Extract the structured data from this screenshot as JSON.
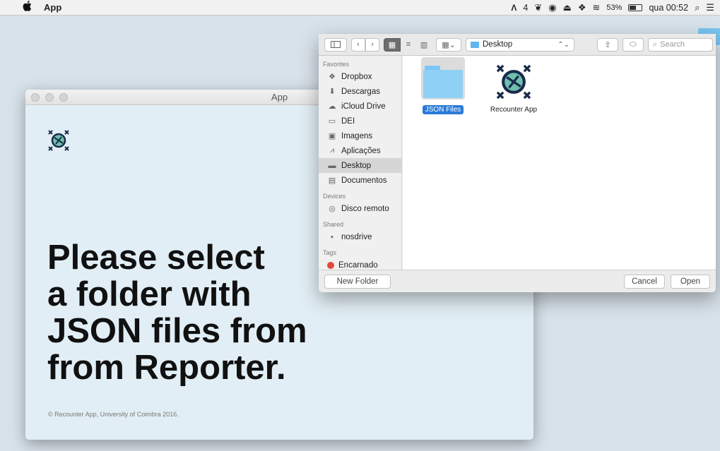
{
  "menubar": {
    "app_name": "App",
    "status_items": [
      "4",
      "53%",
      "qua 00:52"
    ],
    "battery_level": 0.53
  },
  "app_window": {
    "title": "App",
    "headline_lines": [
      "Please select",
      "a folder with",
      "JSON files from",
      "from Reporter."
    ],
    "footer": "© Recounter App, University of Coimbra 2016."
  },
  "dialog": {
    "location": "Desktop",
    "search_placeholder": "Search",
    "sidebar": {
      "favorites_header": "Favorites",
      "favorites": [
        "Dropbox",
        "Descargas",
        "iCloud Drive",
        "DEI",
        "Imagens",
        "Aplicações",
        "Desktop",
        "Documentos"
      ],
      "devices_header": "Devices",
      "devices": [
        "Disco remoto"
      ],
      "shared_header": "Shared",
      "shared": [
        "nosdrive"
      ],
      "tags_header": "Tags",
      "tags": [
        "Encarnado"
      ]
    },
    "files": [
      {
        "name": "JSON Files",
        "kind": "folder",
        "selected": true
      },
      {
        "name": "Recounter App",
        "kind": "app",
        "selected": false
      }
    ],
    "new_folder_label": "New Folder",
    "cancel_label": "Cancel",
    "open_label": "Open"
  },
  "colors": {
    "accent": "#2a7bd8",
    "folder": "#8fd0f6",
    "app_bg": "#e2eef5",
    "logo": "#1a2a4a",
    "tag_red": "#e4453b"
  }
}
